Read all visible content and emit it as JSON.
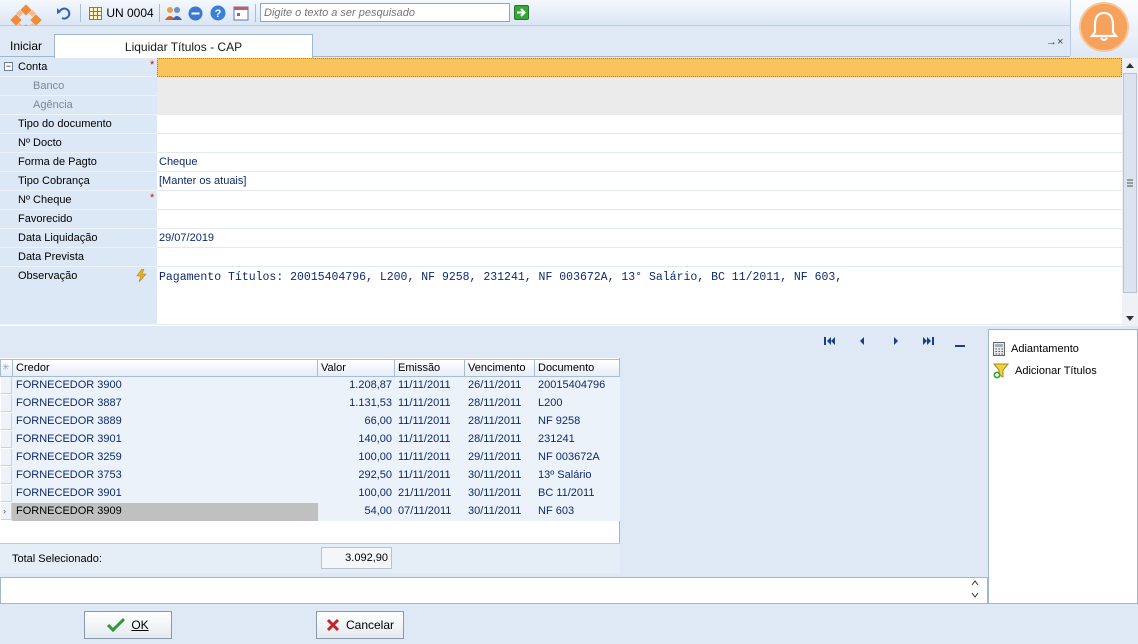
{
  "toolbar": {
    "unit_label": "UN 0004",
    "search_placeholder": "Digite o texto a ser pesquisado"
  },
  "tabs": {
    "start_label": "Iniciar",
    "active_label": "Liquidar Títulos - CAP",
    "close_glyph": "→×"
  },
  "form": {
    "rows": [
      {
        "label": "Conta",
        "value": "",
        "required": true
      },
      {
        "label": "Banco",
        "value": ""
      },
      {
        "label": "Agência",
        "value": ""
      },
      {
        "label": "Tipo do documento",
        "value": ""
      },
      {
        "label": "Nº Docto",
        "value": ""
      },
      {
        "label": "Forma de Pagto",
        "value": "Cheque"
      },
      {
        "label": "Tipo Cobrança",
        "value": "[Manter os atuais]"
      },
      {
        "label": "Nº Cheque",
        "value": "",
        "required": true
      },
      {
        "label": "Favorecido",
        "value": ""
      },
      {
        "label": "Data Liquidação",
        "value": "29/07/2019"
      },
      {
        "label": "Data Prevista",
        "value": ""
      },
      {
        "label": "Observação",
        "value": "Pagamento Títulos: 20015404796, L200, NF 9258, 231241, NF 003672A, 13° Salário, BC 11/2011, NF 603,"
      }
    ],
    "required_mark": "*"
  },
  "grid": {
    "columns": [
      "Credor",
      "Valor",
      "Emissão",
      "Vencimento",
      "Documento"
    ],
    "rows": [
      [
        "FORNECEDOR  3900",
        "1.208,87",
        "11/11/2011",
        "26/11/2011",
        "20015404796"
      ],
      [
        "FORNECEDOR  3887",
        "1.131,53",
        "11/11/2011",
        "28/11/2011",
        "L200"
      ],
      [
        "FORNECEDOR  3889",
        "66,00",
        "11/11/2011",
        "28/11/2011",
        "NF 9258"
      ],
      [
        "FORNECEDOR  3901",
        "140,00",
        "11/11/2011",
        "28/11/2011",
        "231241"
      ],
      [
        "FORNECEDOR  3259",
        "100,00",
        "11/11/2011",
        "29/11/2011",
        "NF 003672A"
      ],
      [
        "FORNECEDOR  3753",
        "292,50",
        "11/11/2011",
        "30/11/2011",
        "13º Salário"
      ],
      [
        "FORNECEDOR  3901",
        "100,00",
        "21/11/2011",
        "30/11/2011",
        "BC 11/2011"
      ],
      [
        "FORNECEDOR  3909",
        "54,00",
        "07/11/2011",
        "30/11/2011",
        "NF 603"
      ]
    ],
    "total_label": "Total Selecionado:",
    "total_value": "3.092,90"
  },
  "side": {
    "items": [
      "Adiantamento",
      "Adicionar Títulos"
    ]
  },
  "buttons": {
    "ok": "OK",
    "cancel": "Cancelar"
  },
  "colors": {
    "required_field": "#fbc35b",
    "panel_bg": "#dfe9f5",
    "accent_orange": "#f6a15c"
  }
}
